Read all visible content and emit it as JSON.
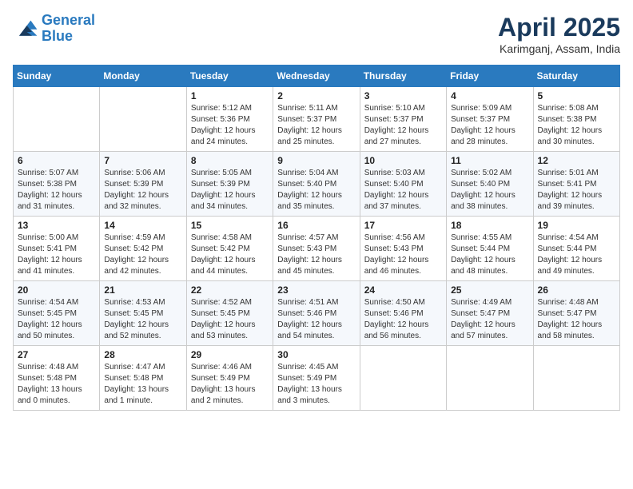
{
  "header": {
    "logo_line1": "General",
    "logo_line2": "Blue",
    "month": "April 2025",
    "location": "Karimganj, Assam, India"
  },
  "weekdays": [
    "Sunday",
    "Monday",
    "Tuesday",
    "Wednesday",
    "Thursday",
    "Friday",
    "Saturday"
  ],
  "weeks": [
    [
      {
        "day": "",
        "content": ""
      },
      {
        "day": "",
        "content": ""
      },
      {
        "day": "1",
        "content": "Sunrise: 5:12 AM\nSunset: 5:36 PM\nDaylight: 12 hours\nand 24 minutes."
      },
      {
        "day": "2",
        "content": "Sunrise: 5:11 AM\nSunset: 5:37 PM\nDaylight: 12 hours\nand 25 minutes."
      },
      {
        "day": "3",
        "content": "Sunrise: 5:10 AM\nSunset: 5:37 PM\nDaylight: 12 hours\nand 27 minutes."
      },
      {
        "day": "4",
        "content": "Sunrise: 5:09 AM\nSunset: 5:37 PM\nDaylight: 12 hours\nand 28 minutes."
      },
      {
        "day": "5",
        "content": "Sunrise: 5:08 AM\nSunset: 5:38 PM\nDaylight: 12 hours\nand 30 minutes."
      }
    ],
    [
      {
        "day": "6",
        "content": "Sunrise: 5:07 AM\nSunset: 5:38 PM\nDaylight: 12 hours\nand 31 minutes."
      },
      {
        "day": "7",
        "content": "Sunrise: 5:06 AM\nSunset: 5:39 PM\nDaylight: 12 hours\nand 32 minutes."
      },
      {
        "day": "8",
        "content": "Sunrise: 5:05 AM\nSunset: 5:39 PM\nDaylight: 12 hours\nand 34 minutes."
      },
      {
        "day": "9",
        "content": "Sunrise: 5:04 AM\nSunset: 5:40 PM\nDaylight: 12 hours\nand 35 minutes."
      },
      {
        "day": "10",
        "content": "Sunrise: 5:03 AM\nSunset: 5:40 PM\nDaylight: 12 hours\nand 37 minutes."
      },
      {
        "day": "11",
        "content": "Sunrise: 5:02 AM\nSunset: 5:40 PM\nDaylight: 12 hours\nand 38 minutes."
      },
      {
        "day": "12",
        "content": "Sunrise: 5:01 AM\nSunset: 5:41 PM\nDaylight: 12 hours\nand 39 minutes."
      }
    ],
    [
      {
        "day": "13",
        "content": "Sunrise: 5:00 AM\nSunset: 5:41 PM\nDaylight: 12 hours\nand 41 minutes."
      },
      {
        "day": "14",
        "content": "Sunrise: 4:59 AM\nSunset: 5:42 PM\nDaylight: 12 hours\nand 42 minutes."
      },
      {
        "day": "15",
        "content": "Sunrise: 4:58 AM\nSunset: 5:42 PM\nDaylight: 12 hours\nand 44 minutes."
      },
      {
        "day": "16",
        "content": "Sunrise: 4:57 AM\nSunset: 5:43 PM\nDaylight: 12 hours\nand 45 minutes."
      },
      {
        "day": "17",
        "content": "Sunrise: 4:56 AM\nSunset: 5:43 PM\nDaylight: 12 hours\nand 46 minutes."
      },
      {
        "day": "18",
        "content": "Sunrise: 4:55 AM\nSunset: 5:44 PM\nDaylight: 12 hours\nand 48 minutes."
      },
      {
        "day": "19",
        "content": "Sunrise: 4:54 AM\nSunset: 5:44 PM\nDaylight: 12 hours\nand 49 minutes."
      }
    ],
    [
      {
        "day": "20",
        "content": "Sunrise: 4:54 AM\nSunset: 5:45 PM\nDaylight: 12 hours\nand 50 minutes."
      },
      {
        "day": "21",
        "content": "Sunrise: 4:53 AM\nSunset: 5:45 PM\nDaylight: 12 hours\nand 52 minutes."
      },
      {
        "day": "22",
        "content": "Sunrise: 4:52 AM\nSunset: 5:45 PM\nDaylight: 12 hours\nand 53 minutes."
      },
      {
        "day": "23",
        "content": "Sunrise: 4:51 AM\nSunset: 5:46 PM\nDaylight: 12 hours\nand 54 minutes."
      },
      {
        "day": "24",
        "content": "Sunrise: 4:50 AM\nSunset: 5:46 PM\nDaylight: 12 hours\nand 56 minutes."
      },
      {
        "day": "25",
        "content": "Sunrise: 4:49 AM\nSunset: 5:47 PM\nDaylight: 12 hours\nand 57 minutes."
      },
      {
        "day": "26",
        "content": "Sunrise: 4:48 AM\nSunset: 5:47 PM\nDaylight: 12 hours\nand 58 minutes."
      }
    ],
    [
      {
        "day": "27",
        "content": "Sunrise: 4:48 AM\nSunset: 5:48 PM\nDaylight: 13 hours\nand 0 minutes."
      },
      {
        "day": "28",
        "content": "Sunrise: 4:47 AM\nSunset: 5:48 PM\nDaylight: 13 hours\nand 1 minute."
      },
      {
        "day": "29",
        "content": "Sunrise: 4:46 AM\nSunset: 5:49 PM\nDaylight: 13 hours\nand 2 minutes."
      },
      {
        "day": "30",
        "content": "Sunrise: 4:45 AM\nSunset: 5:49 PM\nDaylight: 13 hours\nand 3 minutes."
      },
      {
        "day": "",
        "content": ""
      },
      {
        "day": "",
        "content": ""
      },
      {
        "day": "",
        "content": ""
      }
    ]
  ]
}
